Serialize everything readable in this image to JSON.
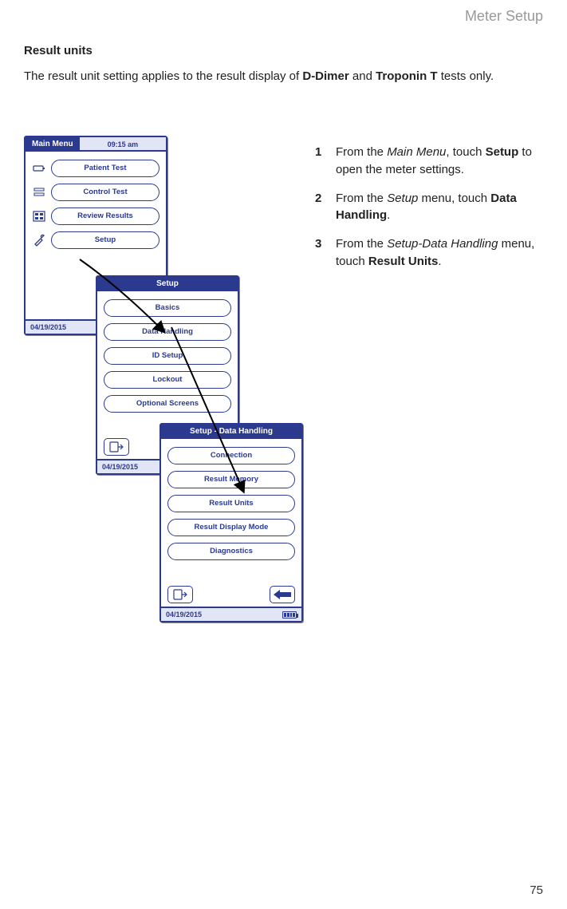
{
  "header": {
    "section": "Meter Setup"
  },
  "title": "Result units",
  "intro": {
    "prefix": "The result unit setting applies to the result display of ",
    "b1": "D-Dimer",
    "and": " and ",
    "b2": "Troponin T",
    "suffix": " tests only."
  },
  "page_number": "75",
  "steps": [
    {
      "num": "1",
      "p1": "From the ",
      "i1": "Main Menu",
      "p2": ", touch ",
      "b1": "Setup",
      "p3": " to open the meter settings."
    },
    {
      "num": "2",
      "p1": "From the ",
      "i1": "Setup",
      "p2": " menu, touch ",
      "b1": "Data Handling",
      "p3": "."
    },
    {
      "num": "3",
      "p1": "From the ",
      "i1": "Setup-Data Handling",
      "p2": " menu, touch ",
      "b1": "Result Units",
      "p3": "."
    }
  ],
  "screen1": {
    "title": "Main Menu",
    "time": "09:15 am",
    "buttons": [
      "Patient Test",
      "Control Test",
      "Review Results",
      "Setup"
    ],
    "date": "04/19/2015"
  },
  "screen2": {
    "title": "Setup",
    "buttons": [
      "Basics",
      "Data Handling",
      "ID Setup",
      "Lockout",
      "Optional Screens"
    ],
    "date": "04/19/2015"
  },
  "screen3": {
    "title": "Setup - Data Handling",
    "buttons": [
      "Connection",
      "Result Memory",
      "Result Units",
      "Result Display Mode",
      "Diagnostics"
    ],
    "date": "04/19/2015"
  }
}
